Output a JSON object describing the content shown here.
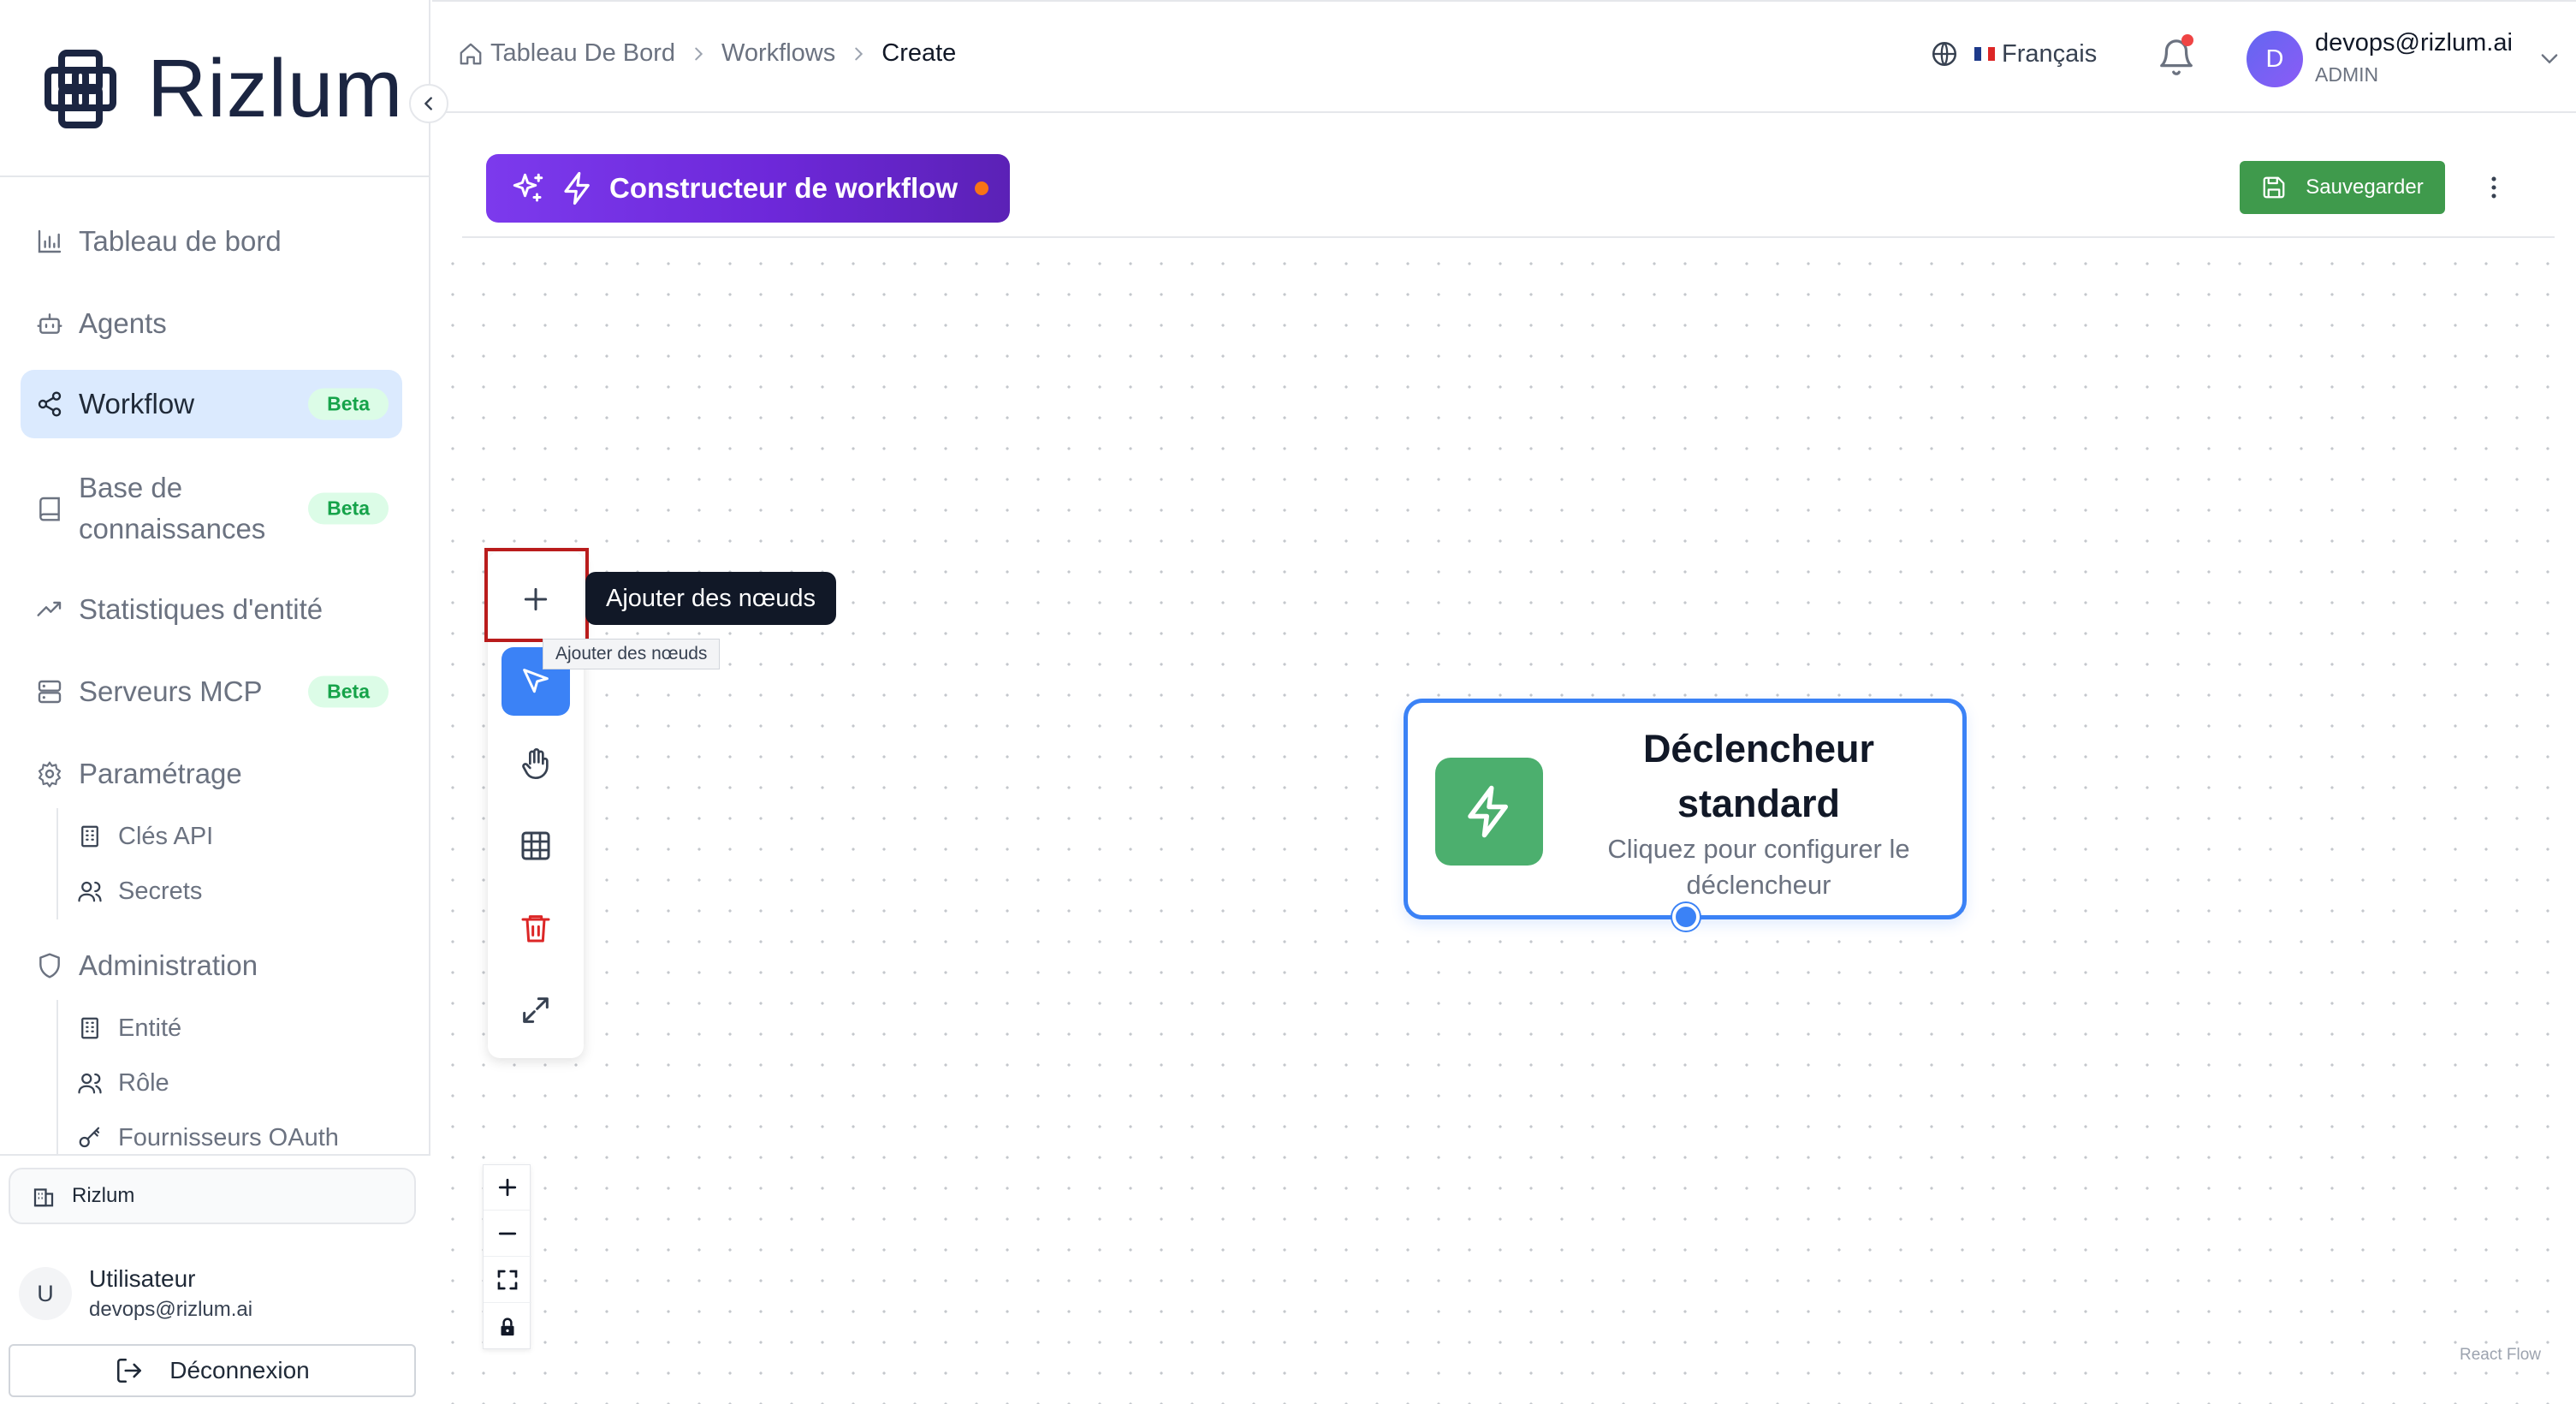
{
  "brand": {
    "name": "Rizlum"
  },
  "sidebar": {
    "items": [
      {
        "label": "Tableau de bord",
        "icon": "bar-chart-icon"
      },
      {
        "label": "Agents",
        "icon": "bot-icon"
      },
      {
        "label": "Workflow",
        "icon": "share-nodes-icon",
        "badge": "Beta",
        "active": true
      },
      {
        "label": "Base de connaissances",
        "icon": "book-icon",
        "badge": "Beta"
      },
      {
        "label": "Statistiques d'entité",
        "icon": "trending-up-icon"
      },
      {
        "label": "Serveurs MCP",
        "icon": "server-icon",
        "badge": "Beta"
      },
      {
        "label": "Paramétrage",
        "icon": "gear-icon"
      },
      {
        "label": "Administration",
        "icon": "shield-icon"
      }
    ],
    "settings_sub": [
      {
        "label": "Clés API",
        "icon": "building-icon"
      },
      {
        "label": "Secrets",
        "icon": "users-icon"
      }
    ],
    "admin_sub": [
      {
        "label": "Entité",
        "icon": "building-icon"
      },
      {
        "label": "Rôle",
        "icon": "users-icon"
      },
      {
        "label": "Fournisseurs OAuth",
        "icon": "key-icon"
      }
    ],
    "org": "Rizlum",
    "user": {
      "initial": "U",
      "name": "Utilisateur",
      "email": "devops@rizlum.ai"
    },
    "logout_label": "Déconnexion"
  },
  "topbar": {
    "breadcrumb": [
      "Tableau De Bord",
      "Workflows",
      "Create"
    ],
    "language": "Français",
    "account": {
      "initial": "D",
      "email": "devops@rizlum.ai",
      "role": "ADMIN"
    }
  },
  "builder": {
    "title": "Constructeur de workflow",
    "save_label": "Sauvegarder"
  },
  "canvas": {
    "tooltip": "Ajouter des nœuds",
    "tooltip_native": "Ajouter des nœuds",
    "trigger": {
      "title": "Déclencheur standard",
      "description": "Cliquez pour configurer le déclencheur"
    },
    "attribution": "React Flow"
  },
  "colors": {
    "accent": "#3b82f6",
    "builder_gradient_start": "#7c3aed",
    "save_green": "#3f9a4c",
    "trigger_green": "#4caf6e",
    "beta_text": "#16a34a",
    "highlight": "#b91c1c",
    "notification_dot": "#ef4444"
  }
}
